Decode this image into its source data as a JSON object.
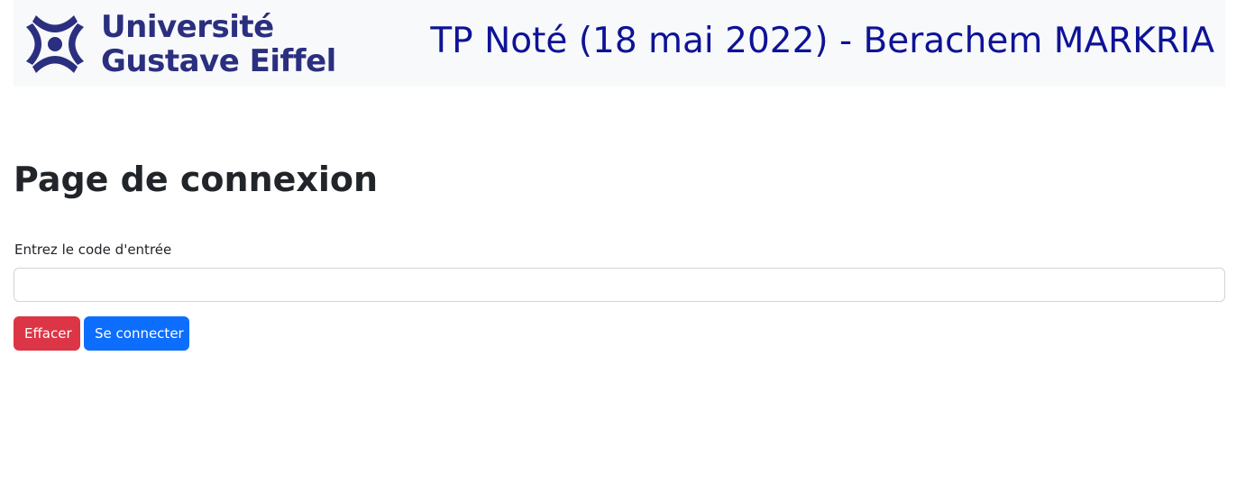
{
  "header": {
    "logo_line1": "Université",
    "logo_line2": "Gustave Eiffel",
    "title": "TP Noté (18 mai 2022) - Berachem MARKRIA",
    "logo_color": "#2b2f7f",
    "title_color": "#0d1397"
  },
  "main": {
    "page_title": "Page de connexion",
    "code_label": "Entrez le code d'entrée",
    "code_value": "",
    "code_placeholder": ""
  },
  "buttons": {
    "clear_label": "Effacer",
    "login_label": "Se connecter",
    "clear_color": "#dc3545",
    "login_color": "#0d6efd"
  }
}
